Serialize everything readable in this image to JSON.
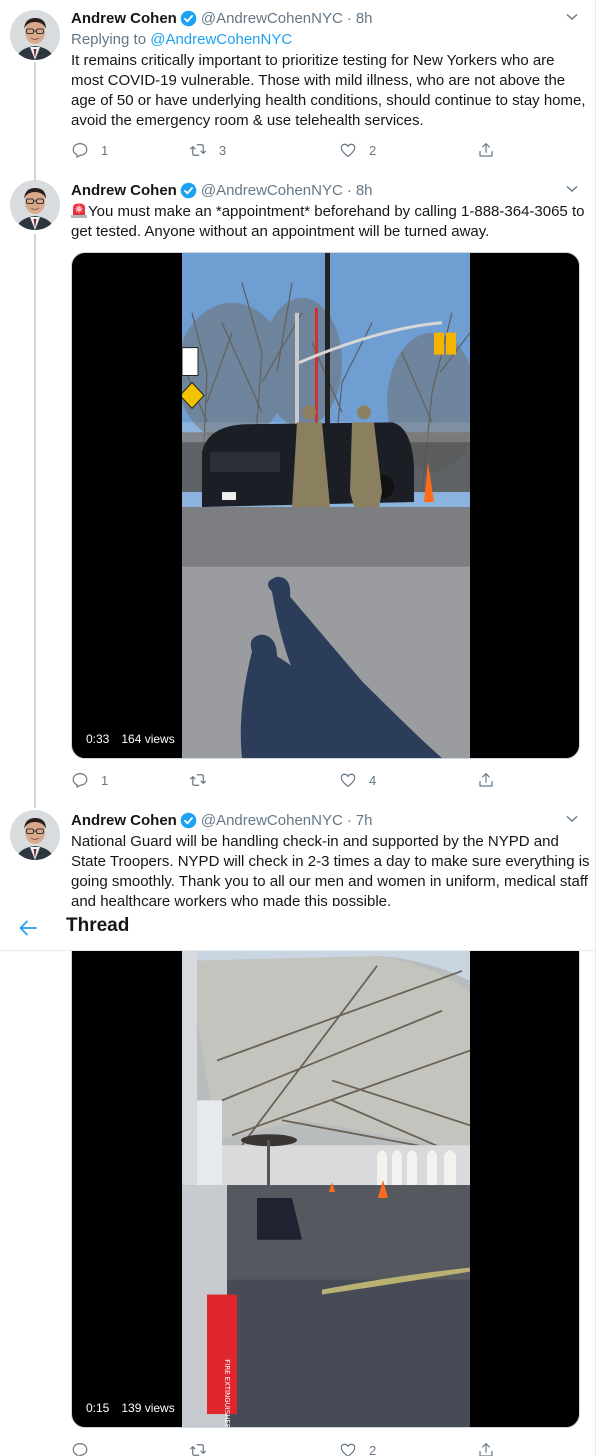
{
  "header": {
    "title": "Thread",
    "back_icon": "arrow-left-icon"
  },
  "colors": {
    "accent": "#1da1f2",
    "secondary_text": "#657786",
    "primary_text": "#14171a",
    "thread_line": "#ccd6dd"
  },
  "tweets": [
    {
      "name": "Andrew Cohen",
      "verified": true,
      "handle": "@AndrewCohenNYC",
      "separator": "·",
      "time": "8h",
      "replying_prefix": "Replying to ",
      "replying_to": "@AndrewCohenNYC",
      "text": "It remains critically important to prioritize testing for New Yorkers who are most COVID-19 vulnerable. Those with mild illness, who are not above the age of 50 or have underlying health conditions, should continue to stay home, avoid the emergency room & use telehealth services.",
      "replies": "1",
      "retweets": "3",
      "likes": "2"
    },
    {
      "name": "Andrew Cohen",
      "verified": true,
      "handle": "@AndrewCohenNYC",
      "separator": "·",
      "time": "8h",
      "emoji": "rotating-light-emoji",
      "text": "You must make an *appointment* beforehand by calling 1-888-364-3065 to get tested. Anyone without an appointment will be turned away.",
      "video": {
        "duration": "0:33",
        "views": "164 views",
        "description": "Soldiers at a checkpoint beside a black SUV, with shadows on pavement"
      },
      "replies": "1",
      "retweets": "",
      "likes": "4"
    },
    {
      "name": "Andrew Cohen",
      "verified": true,
      "handle": "@AndrewCohenNYC",
      "separator": "·",
      "time": "7h",
      "text": "National Guard will be handling check-in and supported by the NYPD and State Troopers. NYPD will check in 2-3 times a day to make sure everything is going smoothly. Thank you to all our men and women in uniform, medical staff and healthcare workers who made this possible.",
      "video": {
        "duration": "0:15",
        "views": "139 views",
        "description": "Interior of a white testing tent with traffic cones and a red fire extinguisher box"
      },
      "replies": "",
      "retweets": "",
      "likes": "2"
    }
  ]
}
